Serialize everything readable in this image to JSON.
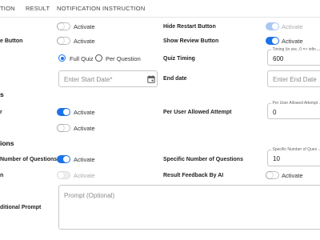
{
  "tabs": [
    "TION",
    "RESULT",
    "NOTIFICATION",
    "INSTRUCTION"
  ],
  "rows": {
    "restart_label": "Hide Restart Button",
    "review_left_label": "e Button",
    "review_right_label": "Show Review Button",
    "quiz_timing_label": "Quiz Timing",
    "end_date_label": "End date",
    "section_s": "s",
    "attempt_left_label": "r",
    "attempt_right_label": "Per User Allowed Attempt",
    "section_ions": "ions",
    "questions_left_label": "Number of Questions",
    "questions_right_label": "Specific Number of Questions",
    "ai_left_label": "n",
    "ai_right_label": "Result Feedback By AI",
    "prompt_left_label": "ditional Prompt"
  },
  "activate": "Activate",
  "radios": {
    "full_quiz": "Full Quiz",
    "per_question": "Per Question"
  },
  "fields": {
    "timing_label": "Timing (in sec, 0 => infin",
    "timing_value": "600",
    "start_date_placeholder": "Enter Start Date*",
    "end_date_placeholder": "Enter End Date",
    "attempt_label": "Per User Allowed Attempt",
    "attempt_value": "0",
    "questions_label": "Specific Number of Ques",
    "questions_value": "10",
    "prompt_placeholder": "Prompt (Optional)"
  },
  "colors": {
    "accent": "#1a73e8"
  }
}
